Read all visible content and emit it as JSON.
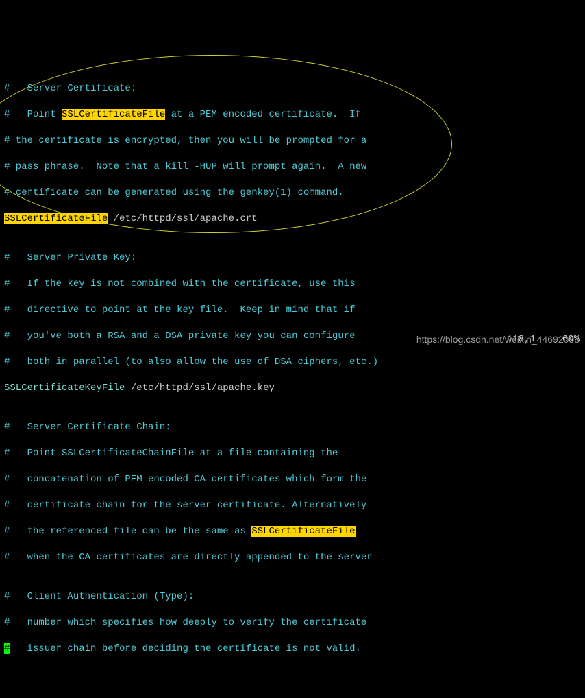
{
  "lines": {
    "l0": "",
    "l1_pre": "#   Server Certificate:",
    "l2_a": "#   Point ",
    "l2_hl": "SSLCertificateFile",
    "l2_b": " at a PEM encoded certificate.  If",
    "l3": "# the certificate is encrypted, then you will be prompted for a",
    "l4": "# pass phrase.  Note that a kill -HUP will prompt again.  A new",
    "l5": "# certificate can be generated using the genkey(1) command.",
    "l6_hl": "SSLCertificateFile",
    "l6_path": " /etc/httpd/ssl/apache.crt",
    "l7": "",
    "l8": "#   Server Private Key:",
    "l9": "#   If the key is not combined with the certificate, use this",
    "l10": "#   directive to point at the key file.  Keep in mind that if",
    "l11": "#   you've both a RSA and a DSA private key you can configure",
    "l12": "#   both in parallel (to also allow the use of DSA ciphers, etc.)",
    "l13_dir": "SSLCertificateKeyFile",
    "l13_path": " /etc/httpd/ssl/apache.key",
    "l14": "",
    "l15": "#   Server Certificate Chain:",
    "l16": "#   Point SSLCertificateChainFile at a file containing the",
    "l17": "#   concatenation of PEM encoded CA certificates which form the",
    "l18": "#   certificate chain for the server certificate. Alternatively",
    "l19_a": "#   the referenced file can be the same as ",
    "l19_hl": "SSLCertificateFile",
    "l20": "#   when the CA certificates are directly appended to the server",
    "l21": "",
    "l22": "#   Client Authentication (Type):",
    "l23": "#   number which specifies how deeply to verify the certificate",
    "l24_cur": "#",
    "l24_b": "   issuer chain before deciding the certificate is not valid."
  },
  "status_pos": "118,1",
  "status_pct": "60%",
  "watermark": "https://blog.csdn.net/weixin_44692093"
}
